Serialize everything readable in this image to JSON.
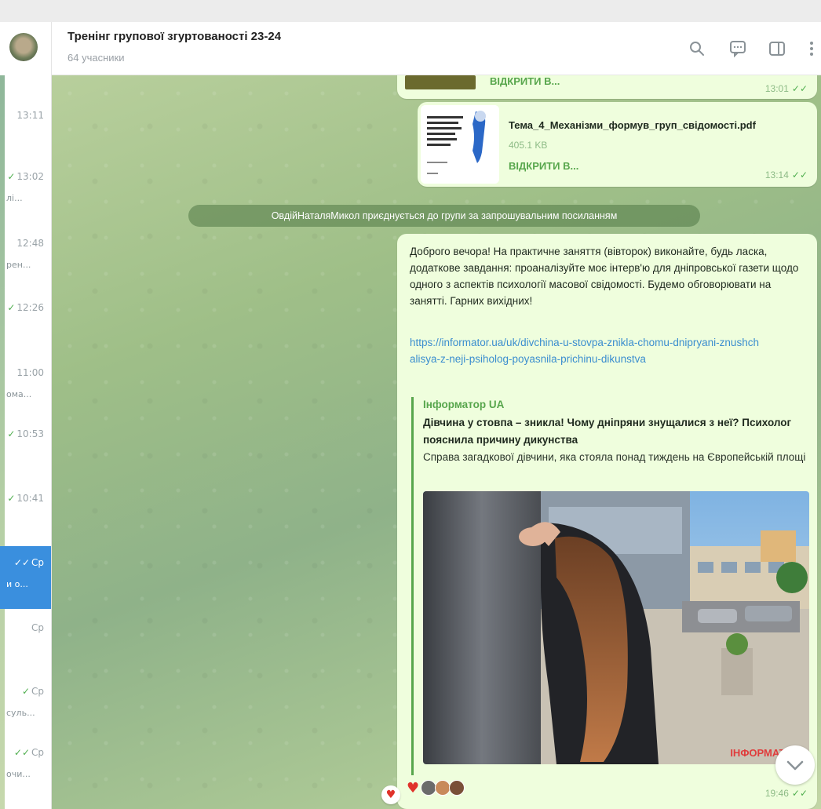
{
  "chat": {
    "title": "Тренінг групової згуртованості 23-24",
    "members": "64 учасники"
  },
  "chat_list": [
    {
      "time": "13:11",
      "preview": ""
    },
    {
      "time": "13:02",
      "preview": "лі..."
    },
    {
      "time": "12:48",
      "preview": "рен..."
    },
    {
      "time": "12:26",
      "preview": ""
    },
    {
      "time": "11:00",
      "preview": "ома..."
    },
    {
      "time": "10:53",
      "preview": ""
    },
    {
      "time": "10:41",
      "preview": ""
    },
    {
      "time": "Ср",
      "preview": "и о...",
      "active": true
    },
    {
      "time": "Ср",
      "preview": ""
    },
    {
      "time": "Ср",
      "preview": "суль..."
    },
    {
      "time": "Ср",
      "preview": "очи..."
    }
  ],
  "messages": {
    "file1": {
      "open_label": "ВІДКРИТИ В...",
      "time": "13:01"
    },
    "file2": {
      "filename": "Тема_4_Механізми_формув_груп_свідомості.pdf",
      "size": "405.1 KB",
      "open_label": "ВІДКРИТИ В...",
      "time": "13:14"
    },
    "service": "ОвдійНаталяМикол приєднується до групи за запрошувальним посиланням",
    "post": {
      "text": "Доброго вечора! На практичне заняття (вівторок) виконайте, будь ласка, додаткове завдання: проаналізуйте моє інтерв'ю для дніпровської газети щодо одного з аспектів психології масової свідомості. Будемо обговорювати на занятті. Гарних вихідних!",
      "link": "https://informator.ua/uk/divchina-u-stovpa-znikla-chomu-dnipryani-znushchalisya-z-neji-psiholog-poyasnila-prichinu-dikunstva",
      "preview_site": "Інформатор UA",
      "preview_title": "Дівчина у стовпа – зникла! Чому дніпряни знущалися з неї? Психолог пояснила причину дикунства",
      "preview_desc": "Справа загадкової дівчини, яка стояла понад тиждень на Європейській площі пішла за найгіршим сценарієм - вона зн...",
      "watermark": "ІНФОРМАТОР",
      "time": "19:46"
    }
  },
  "icons": [
    "search-icon",
    "comments-icon",
    "sidebar-toggle-icon",
    "more-icon",
    "double-check-icon",
    "heart-icon",
    "chevron-down-icon"
  ],
  "colors": {
    "accent": "#3a8fde",
    "bubble": "#effedd",
    "link": "#3b8ecf",
    "green_text": "#57a64c",
    "heart": "#e0322a"
  }
}
